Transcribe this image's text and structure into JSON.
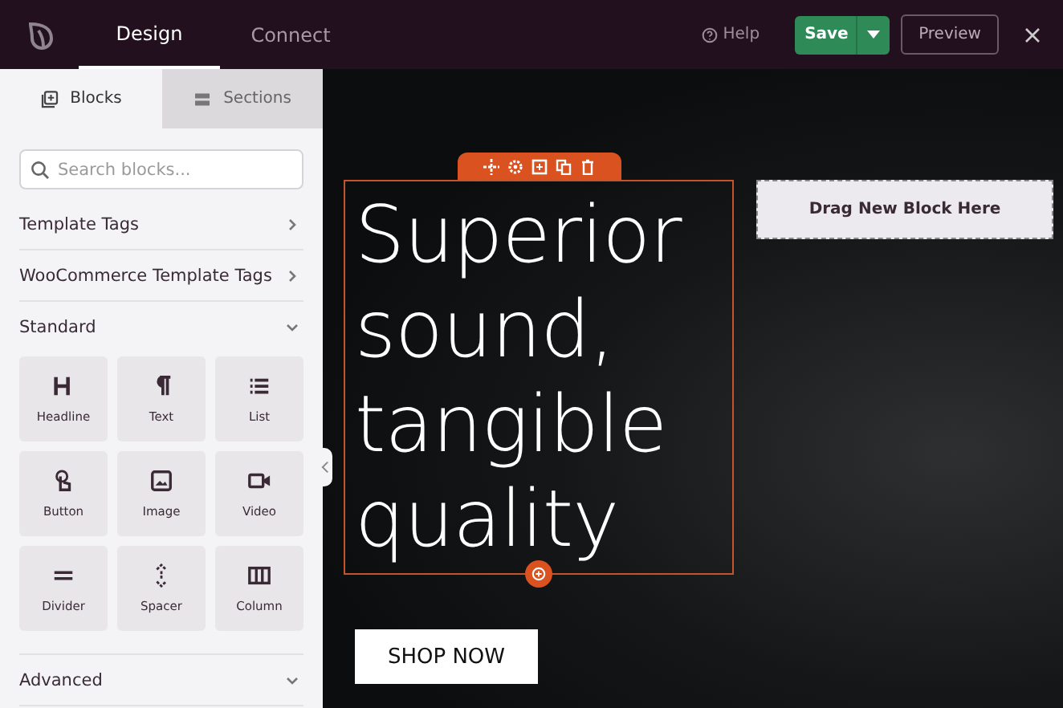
{
  "top_bar": {
    "tabs": [
      {
        "label": "Design",
        "selected": true
      },
      {
        "label": "Connect",
        "selected": false
      }
    ],
    "help": "Help",
    "save": "Save",
    "preview": "Preview"
  },
  "sidebar": {
    "tabs": [
      {
        "label": "Blocks",
        "kind": "blocks",
        "selected": true
      },
      {
        "label": "Sections",
        "kind": "sections",
        "selected": false
      }
    ],
    "search": {
      "placeholder": "Search blocks..."
    },
    "groups": [
      {
        "title": "Template Tags",
        "expanded": false
      },
      {
        "title": "WooCommerce Template Tags",
        "expanded": false
      },
      {
        "title": "Standard",
        "expanded": true,
        "blocks": [
          {
            "label": "Headline",
            "kind": "headline"
          },
          {
            "label": "Text",
            "kind": "text"
          },
          {
            "label": "List",
            "kind": "list"
          },
          {
            "label": "Button",
            "kind": "button"
          },
          {
            "label": "Image",
            "kind": "image"
          },
          {
            "label": "Video",
            "kind": "video"
          },
          {
            "label": "Divider",
            "kind": "divider"
          },
          {
            "label": "Spacer",
            "kind": "spacer"
          },
          {
            "label": "Column",
            "kind": "column"
          }
        ]
      },
      {
        "title": "Advanced",
        "expanded": true
      }
    ]
  },
  "canvas": {
    "headline": "Superior sound, tangible quality",
    "drop_zone": "Drag New Block Here",
    "button": "SHOP NOW"
  }
}
